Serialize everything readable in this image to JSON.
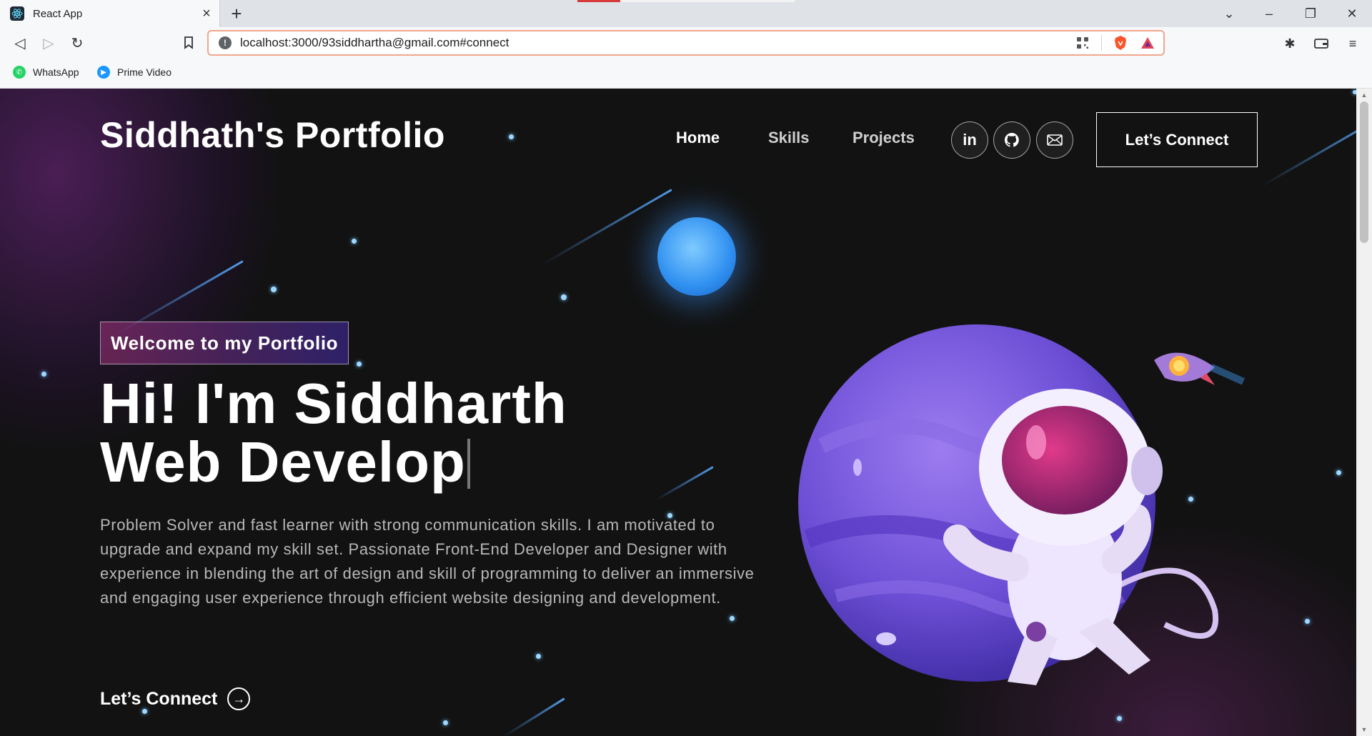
{
  "browser": {
    "tab_title": "React App",
    "url": "localhost:3000/93siddhartha@gmail.com#connect",
    "bookmarks": [
      {
        "label": "WhatsApp",
        "icon": "whatsapp-icon",
        "color": "#25d366"
      },
      {
        "label": "Prime Video",
        "icon": "prime-video-icon",
        "color": "#1a98ff"
      }
    ]
  },
  "site": {
    "brand": "Siddhath's Portfolio",
    "nav": [
      {
        "label": "Home"
      },
      {
        "label": "Skills"
      },
      {
        "label": "Projects"
      }
    ],
    "social": [
      {
        "icon": "linkedin-icon",
        "glyph": "in"
      },
      {
        "icon": "github-icon",
        "glyph": "◐"
      },
      {
        "icon": "mail-icon",
        "glyph": "✉"
      }
    ],
    "connect_label": "Let’s Connect"
  },
  "hero": {
    "tagline": "Welcome to my Portfolio",
    "line1": "Hi! I'm Siddharth",
    "line2": "Web Develop",
    "description": "Problem Solver and fast learner with strong communication skills. I am motivated to upgrade and expand my skill set. Passionate Front-End Developer and Designer with experience in blending the art of design and skill of programming to deliver an immersive and engaging user experience through efficient website designing and development.",
    "cta_label": "Let’s Connect",
    "cta_icon": "arrow-right-icon"
  },
  "colors": {
    "accent_gradient_start": "#aa367c",
    "accent_gradient_end": "#4a2fbd",
    "background": "#121212"
  }
}
